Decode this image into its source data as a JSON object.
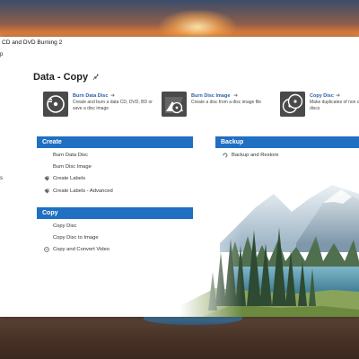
{
  "window": {
    "title": "CD and DVD Burning 2",
    "menu_label": "p",
    "side_letter": "s"
  },
  "page": {
    "title": "Data - Copy",
    "pin_icon": "pin-icon"
  },
  "tiles": [
    {
      "name": "Burn Data Disc",
      "icon": "data-disc-icon",
      "description": "Create and burn a data CD, DVD, BD or save a disc image"
    },
    {
      "name": "Burn Disc Image",
      "icon": "disc-image-icon",
      "description": "Create a disc from a disc image file"
    },
    {
      "name": "Copy Disc",
      "icon": "copy-disc-icon",
      "description": "Make duplicates of non copy-protected discs"
    }
  ],
  "sections": {
    "create": {
      "header": "Create",
      "items": [
        {
          "label": "Burn Data Disc",
          "icon": ""
        },
        {
          "label": "Burn Disc Image",
          "icon": ""
        },
        {
          "label": "Create Labels",
          "icon": "label-icon"
        },
        {
          "label": "Create Labels - Advanced",
          "icon": "label-icon"
        }
      ]
    },
    "copy": {
      "header": "Copy",
      "items": [
        {
          "label": "Copy Disc",
          "icon": ""
        },
        {
          "label": "Copy Disc to Image",
          "icon": ""
        },
        {
          "label": "Copy and Convert Video",
          "icon": "convert-icon"
        }
      ]
    },
    "backup": {
      "header": "Backup",
      "items": [
        {
          "label": "Backup and Restore",
          "icon": "backup-icon"
        }
      ]
    }
  },
  "colors": {
    "section_header": "#1f6fc2",
    "tile_name": "#2a5da8",
    "tile_icon_bg": "#4a4a4a"
  }
}
